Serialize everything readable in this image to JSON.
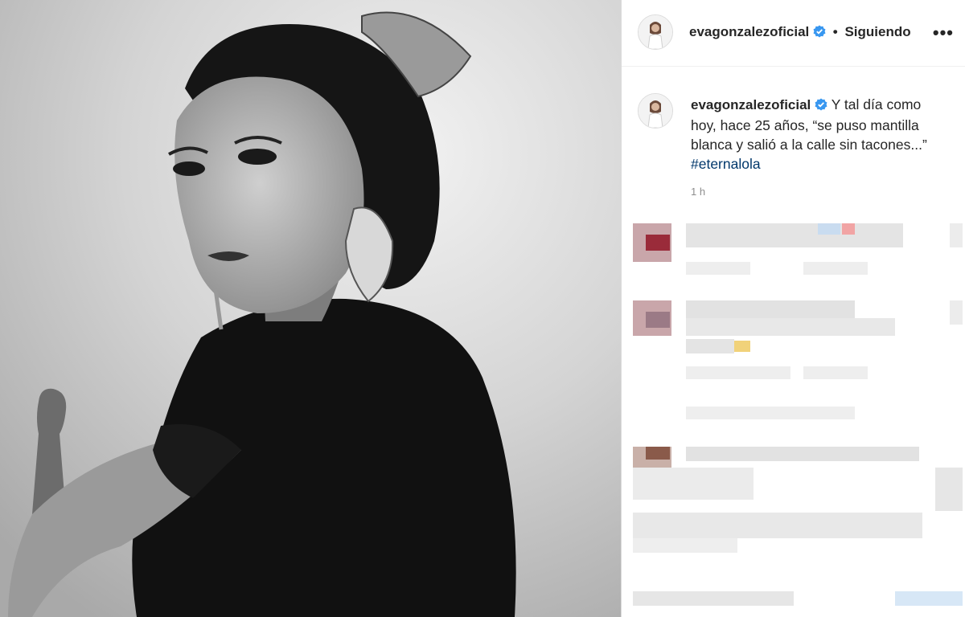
{
  "post": {
    "author": "evagonzalezoficial",
    "follow_status": "Siguiendo",
    "caption_text": "Y tal día como hoy, hace 25 años, “se puso mantilla blanca y salió a la calle sin tacones...”",
    "hashtag": "#eternalola",
    "time_ago": "1 h"
  },
  "icons": {
    "verified": "verified-badge-icon",
    "more": "more-options-icon"
  },
  "colors": {
    "text": "#262626",
    "muted": "#8e8e8e",
    "hashtag": "#00376b",
    "verified": "#3897f0",
    "border": "#dbdbdb"
  }
}
